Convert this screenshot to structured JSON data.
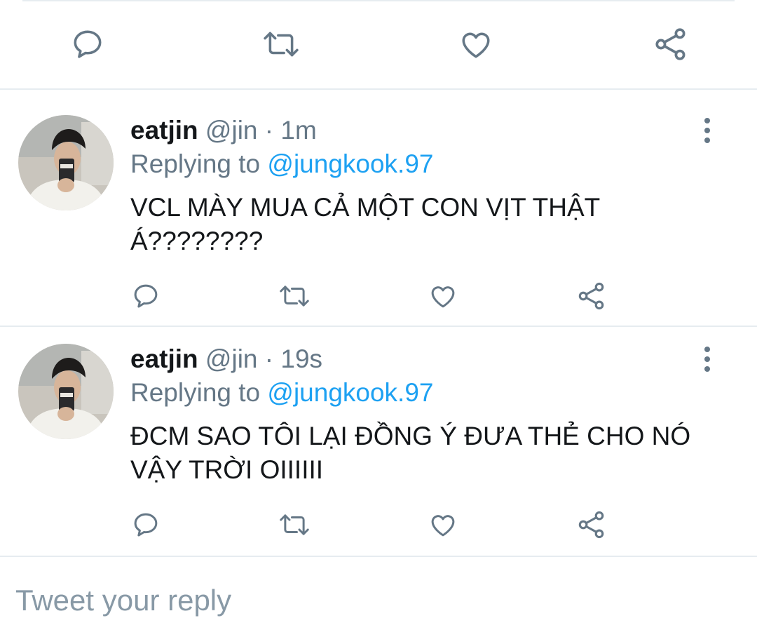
{
  "colors": {
    "accent": "#1da1f2",
    "icon_gray": "#657786",
    "divider": "#e6ecf0",
    "text": "#14171a"
  },
  "main_tweet_actions": [
    "reply-icon",
    "retweet-icon",
    "like-icon",
    "share-icon"
  ],
  "replies": [
    {
      "display_name": "eatjin",
      "handle": "@jin",
      "separator": "·",
      "time": "1m",
      "replying_prefix": "Replying to",
      "replying_to": "@jungkook.97",
      "text": "VCL MÀY MUA CẢ MỘT CON VỊT THẬT Á????????",
      "actions": [
        "reply-icon",
        "retweet-icon",
        "like-icon",
        "share-icon"
      ]
    },
    {
      "display_name": "eatjin",
      "handle": "@jin",
      "separator": "·",
      "time": "19s",
      "replying_prefix": "Replying to",
      "replying_to": "@jungkook.97",
      "text": "ĐCM SAO TÔI LẠI ĐỒNG Ý ĐƯA THẺ CHO NÓ VẬY TRỜI OIIIIII",
      "actions": [
        "reply-icon",
        "retweet-icon",
        "like-icon",
        "share-icon"
      ]
    }
  ],
  "composer": {
    "placeholder": "Tweet your reply"
  }
}
